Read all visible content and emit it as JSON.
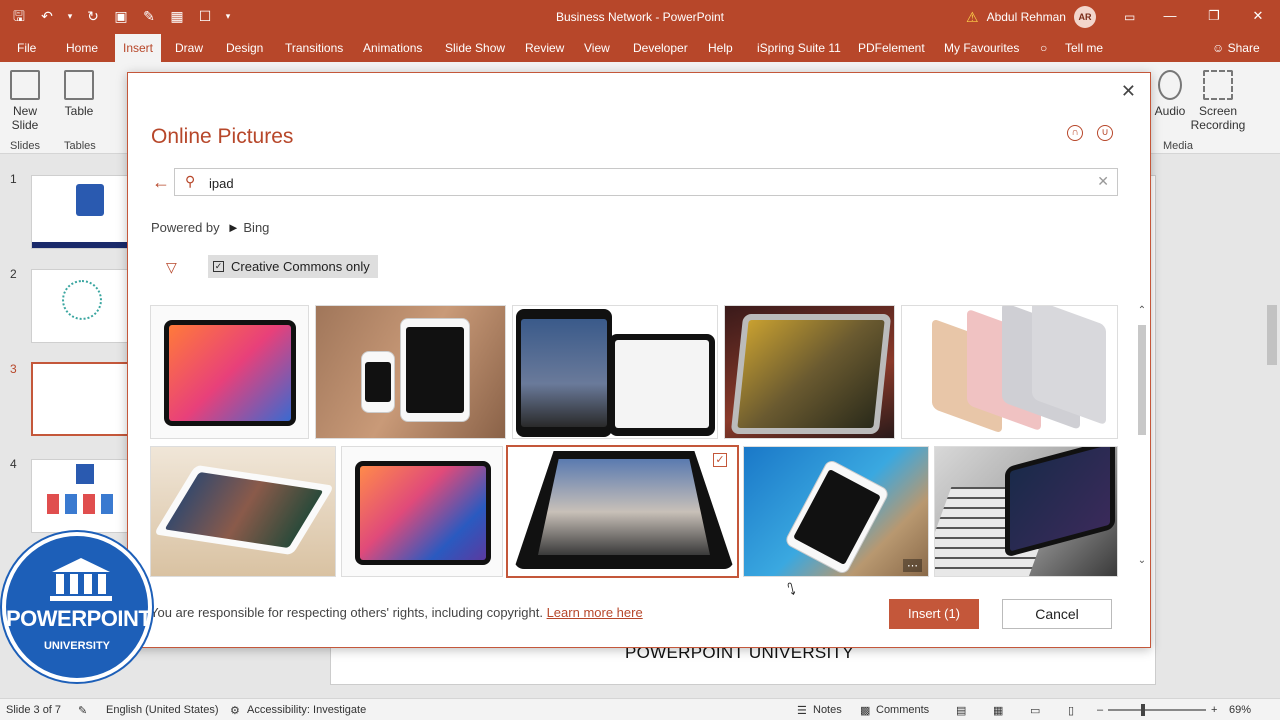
{
  "window": {
    "title": "Business Network  -  PowerPoint",
    "user_name": "Abdul Rehman",
    "user_initials": "AR"
  },
  "ribbon_tabs": [
    "File",
    "Home",
    "Insert",
    "Draw",
    "Design",
    "Transitions",
    "Animations",
    "Slide Show",
    "Review",
    "View",
    "Developer",
    "Help",
    "iSpring Suite 11",
    "PDFelement",
    "My Favourites",
    "Tell me",
    "Share"
  ],
  "active_tab": "Insert",
  "ribbon": {
    "new_slide_line1": "New",
    "new_slide_line2": "Slide",
    "table": "Table",
    "group_slides": "Slides",
    "group_tables": "Tables",
    "audio": "Audio",
    "screen_recording_line1": "Screen",
    "screen_recording_line2": "Recording",
    "group_media": "Media"
  },
  "slides": [
    "1",
    "2",
    "3",
    "4"
  ],
  "active_slide": "3",
  "dialog": {
    "title": "Online Pictures",
    "search_query": "ipad",
    "powered_by": "Powered by",
    "engine": "Bing",
    "creative_commons": "Creative Commons only",
    "creative_commons_checked": true,
    "copyright_text": "You are responsible for respecting others' rights, including copyright.",
    "learn_more": "Learn more here",
    "insert_button": "Insert (1)",
    "cancel_button": "Cancel",
    "selected_count": 1
  },
  "slide_footer_text": "POWERPOINT UNIVERSITY",
  "watermark": {
    "line1": "POWERPOINT",
    "line2": "UNIVERSITY"
  },
  "status": {
    "slide_info": "Slide 3 of 7",
    "language": "English (United States)",
    "accessibility": "Accessibility: Investigate",
    "notes": "Notes",
    "comments": "Comments",
    "zoom": "69%"
  },
  "colors": {
    "accent": "#b7472a",
    "selection": "#c4573a"
  }
}
